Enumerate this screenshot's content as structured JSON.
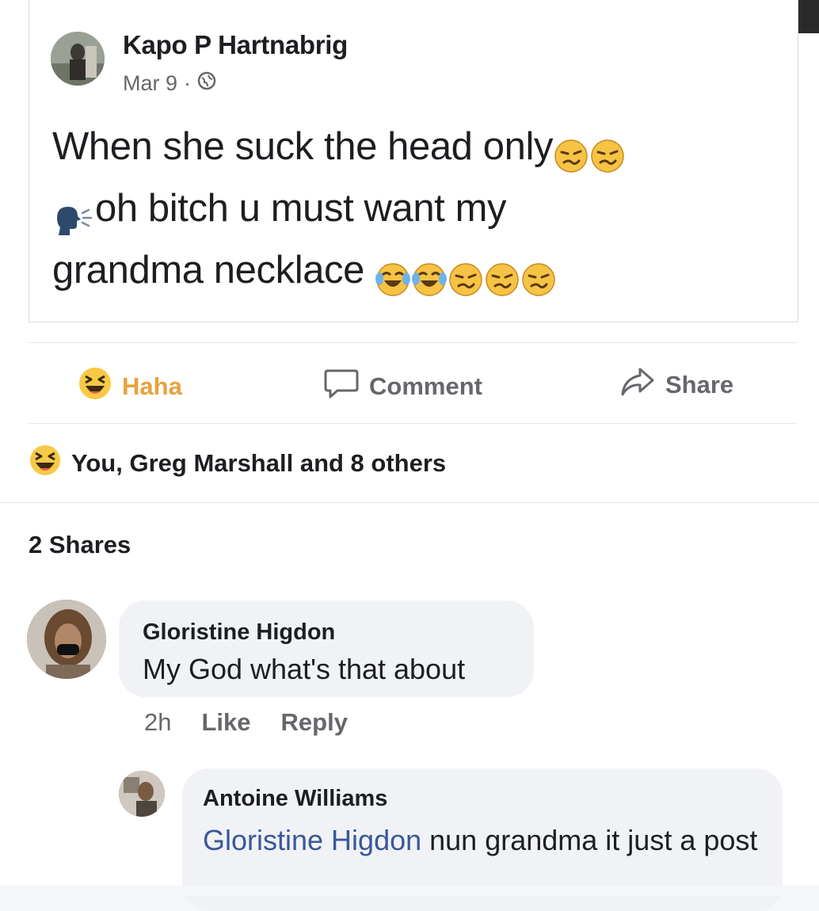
{
  "post": {
    "author_name": "Kapo P Hartnabrig",
    "date": "Mar 9",
    "meta_separator": "·",
    "text_line1": "When she suck the head only",
    "text_line2": "oh bitch u must want my",
    "text_line3": "grandma necklace"
  },
  "actions": {
    "haha_label": "Haha",
    "comment_label": "Comment",
    "share_label": "Share"
  },
  "reactions": {
    "summary": "You, Greg Marshall and 8 others"
  },
  "shares": {
    "label": "2 Shares"
  },
  "comments": [
    {
      "author": "Gloristine Higdon",
      "text": "My God what's that about",
      "time": "2h",
      "like_label": "Like",
      "reply_label": "Reply"
    },
    {
      "author": "Antoine Williams",
      "mention": "Gloristine Higdon",
      "text": " nun grandma it just a post"
    }
  ],
  "colors": {
    "haha_yellow": "#e7a23a",
    "mention_blue": "#385898",
    "muted_gray": "#65676b"
  }
}
